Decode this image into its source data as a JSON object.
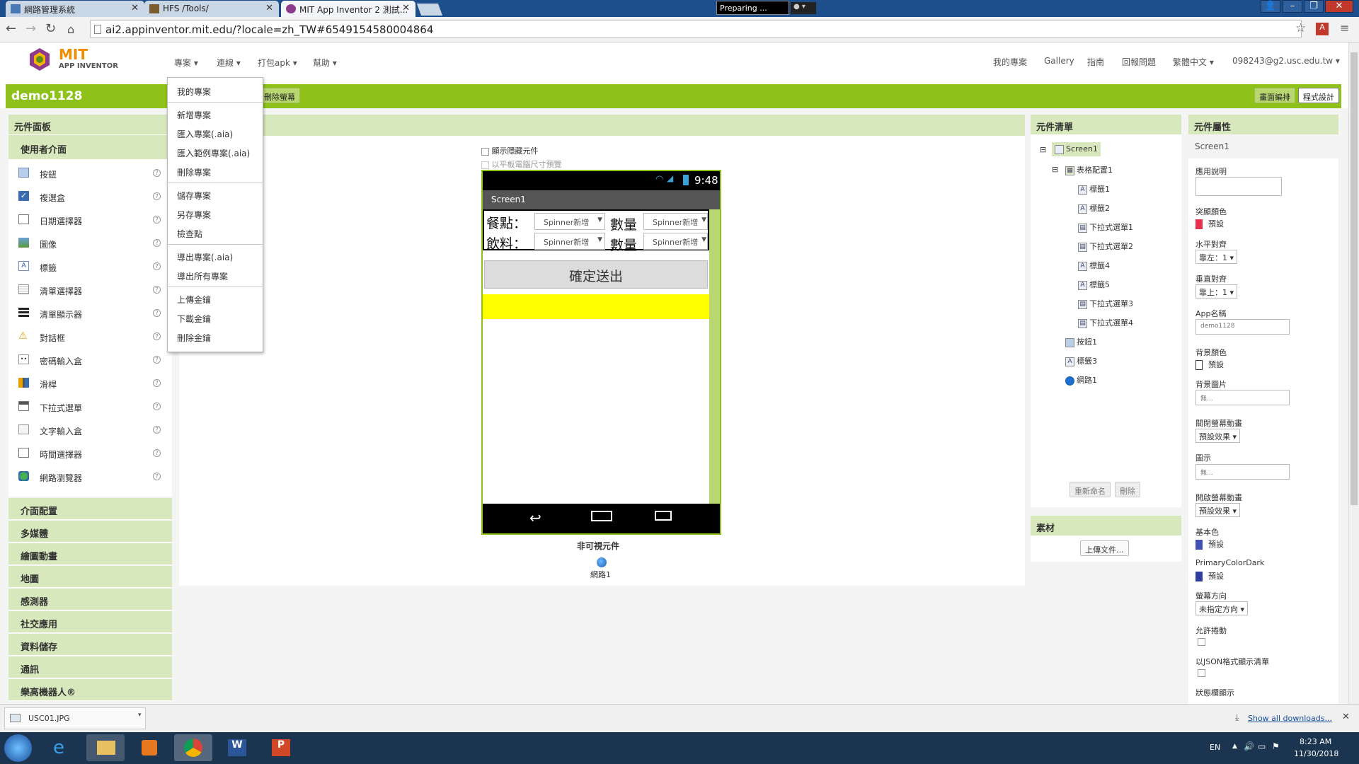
{
  "browser": {
    "tabs": [
      {
        "title": "網路管理系統"
      },
      {
        "title": "HFS /Tools/"
      },
      {
        "title": "MIT App Inventor 2 測試..."
      }
    ],
    "preparing_label": "Preparing ...",
    "url": "ai2.appinventor.mit.edu/?locale=zh_TW#6549154580004864"
  },
  "header": {
    "logo_line1": "MIT",
    "logo_line2": "APP INVENTOR",
    "menus": [
      "專案 ▾",
      "連線 ▾",
      "打包apk ▾",
      "幫助 ▾"
    ],
    "right_links": [
      "我的專案",
      "Gallery",
      "指南",
      "回報問題",
      "繁體中文 ▾",
      "098243@g2.usc.edu.tw ▾"
    ]
  },
  "project_bar": {
    "name": "demo1128",
    "delete_screen": "刪除螢幕",
    "designer": "畫面編排",
    "blocks": "程式設計"
  },
  "project_menu": [
    "我的專案",
    "新增專案",
    "匯入專案(.aia)",
    "匯入範例專案(.aia)",
    "刪除專案",
    "儲存專案",
    "另存專案",
    "檢查點",
    "導出專案(.aia)",
    "導出所有專案",
    "上傳金鑰",
    "下載金鑰",
    "刪除金鑰"
  ],
  "palette": {
    "title": "元件面板",
    "ui_category": "使用者介面",
    "items": [
      "按鈕",
      "複選盒",
      "日期選擇器",
      "圖像",
      "標籤",
      "清單選擇器",
      "清單顯示器",
      "對話框",
      "密碼輸入盒",
      "滑桿",
      "下拉式選單",
      "文字輸入盒",
      "時間選擇器",
      "網路瀏覽器"
    ],
    "categories": [
      "介面配置",
      "多媒體",
      "繪圖動畫",
      "地圖",
      "感測器",
      "社交應用",
      "資料儲存",
      "通訊",
      "樂高機器人®"
    ]
  },
  "viewer": {
    "hidden_components_label": "顯示隱藏元件",
    "tablet_preview_label": "以平板電腦尺寸預覽",
    "time": "9:48",
    "screen_title": "Screen1",
    "row1_label": "餐點：",
    "row2_label": "飲料：",
    "qty_label": "數量",
    "spinner_text": "Spinner新增",
    "submit_button": "確定送出",
    "non_visible_title": "非可視元件",
    "non_visible_item": "網路1",
    "yellow": "#ffff00"
  },
  "components": {
    "title": "元件清單",
    "tree": [
      "Screen1",
      "表格配置1",
      "標籤1",
      "標籤2",
      "下拉式選單1",
      "下拉式選單2",
      "標籤4",
      "標籤5",
      "下拉式選單3",
      "下拉式選單4",
      "按鈕1",
      "標籤3",
      "網路1"
    ],
    "rename": "重新命名",
    "delete": "刪除"
  },
  "media": {
    "title": "素材",
    "upload": "上傳文件..."
  },
  "properties": {
    "title": "元件屬性",
    "component": "Screen1",
    "about_label": "應用說明",
    "accent_label": "突顯顏色",
    "accent_value": "預設",
    "halign_label": "水平對齊",
    "halign_value": "靠左：1 ▾",
    "valign_label": "垂直對齊",
    "valign_value": "靠上：1 ▾",
    "appname_label": "App名稱",
    "appname_value": "demo1128",
    "bgcolor_label": "背景顏色",
    "bgcolor_value": "預設",
    "bgimage_label": "背景圖片",
    "bgimage_value": "無...",
    "closeanim_label": "關閉螢幕動畫",
    "closeanim_value": "預設效果 ▾",
    "icon_label": "圖示",
    "icon_value": "無...",
    "openanim_label": "開啟螢幕動畫",
    "openanim_value": "預設效果 ▾",
    "primary_label": "基本色",
    "primary_value": "預設",
    "primarydark_label": "PrimaryColorDark",
    "primarydark_value": "預設",
    "orientation_label": "螢幕方向",
    "orientation_value": "未指定方向 ▾",
    "scroll_label": "允許捲動",
    "json_label": "以JSON格式顯示清單",
    "statusbar_label": "狀態欄顯示",
    "accent_color": "#e8304f",
    "primary_color": "#3f51b5",
    "primarydark_color": "#303f9f"
  },
  "downloads": {
    "file": "USC01.JPG",
    "show_all": "Show all downloads..."
  },
  "taskbar": {
    "lang": "EN",
    "time": "8:23 AM",
    "date": "11/30/2018"
  }
}
